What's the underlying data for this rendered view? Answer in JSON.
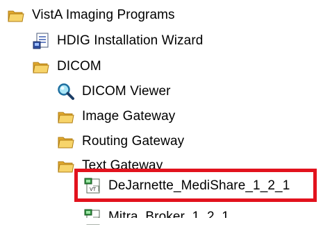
{
  "tree": {
    "root": {
      "label": "VistA Imaging Programs",
      "icon": "folder-icon"
    },
    "items": [
      {
        "label": "HDIG Installation Wizard",
        "icon": "installer-icon"
      },
      {
        "label": "DICOM",
        "icon": "folder-icon"
      },
      {
        "label": "DICOM Viewer",
        "icon": "magnifier-icon"
      },
      {
        "label": "Image Gateway",
        "icon": "folder-icon"
      },
      {
        "label": "Routing Gateway",
        "icon": "folder-icon"
      },
      {
        "label": "Text Gateway",
        "icon": "folder-icon"
      },
      {
        "label": "DeJarnette_MediShare_1_2_1",
        "icon": "vt-shortcut-icon"
      },
      {
        "label": "Mitra_Broker_1_2_1",
        "icon": "vt-shortcut-icon"
      }
    ]
  },
  "colors": {
    "highlight_border": "#e2121d",
    "folder": "#f2c24a"
  }
}
